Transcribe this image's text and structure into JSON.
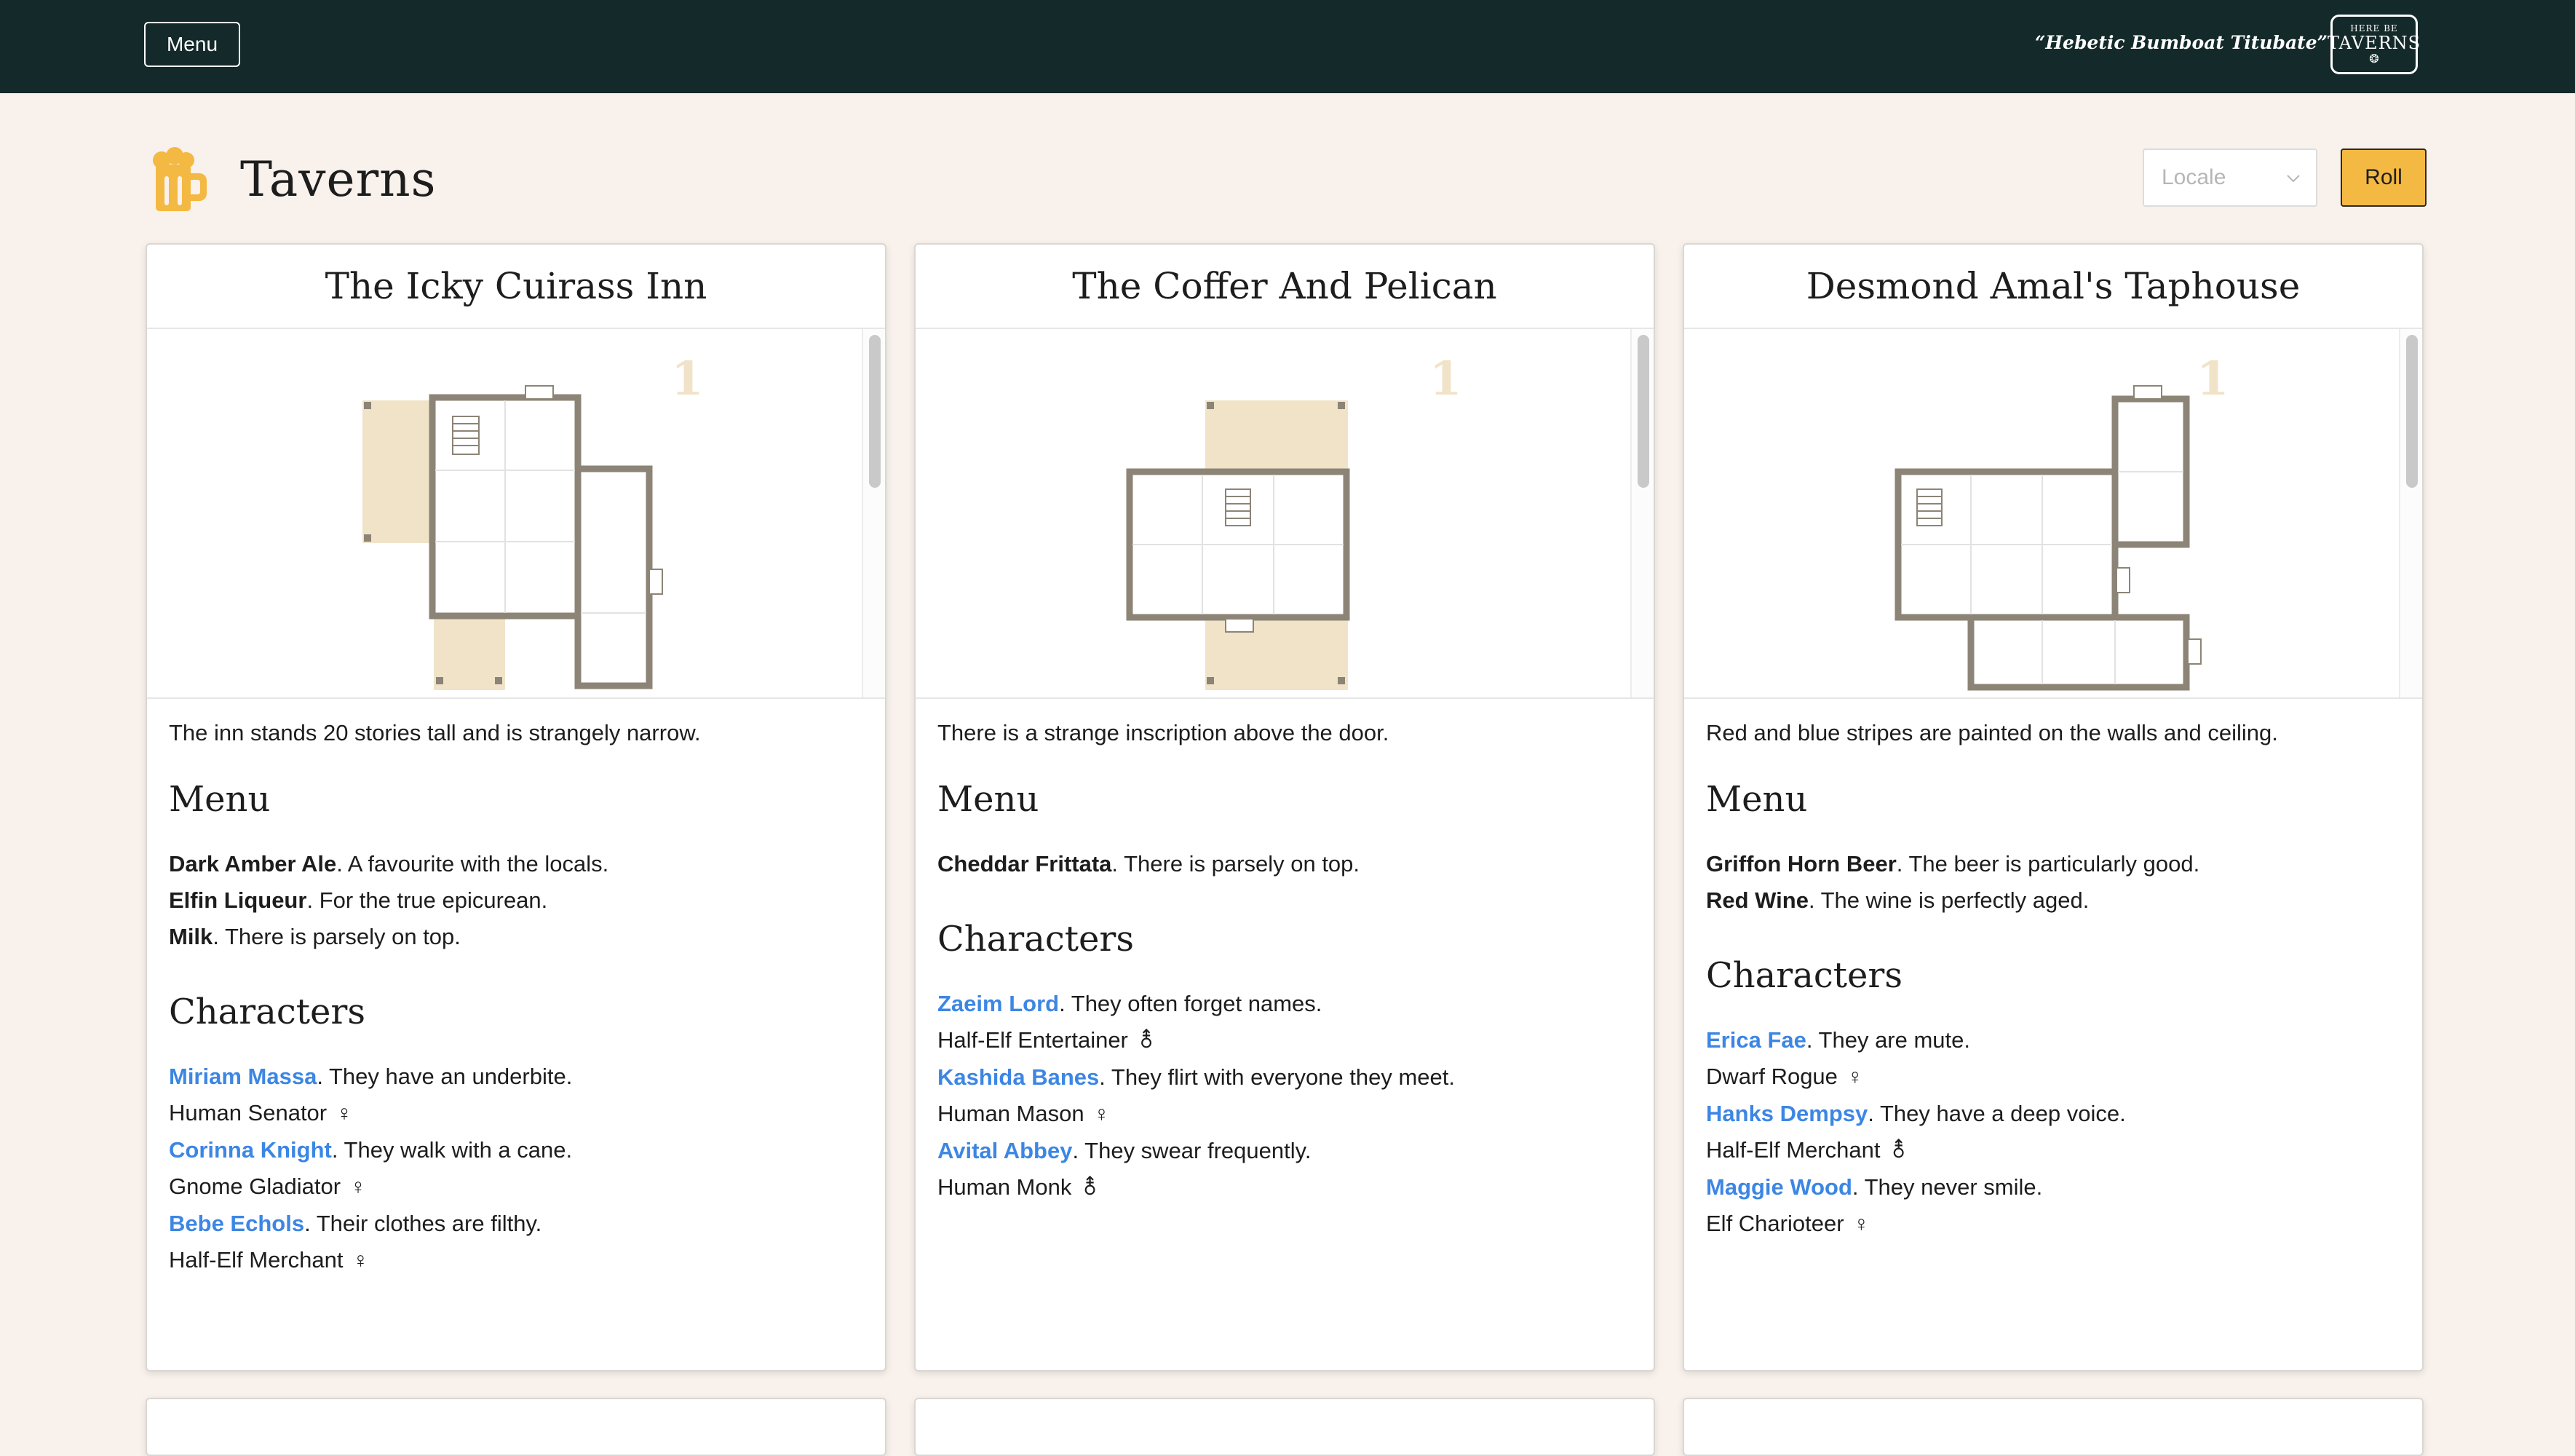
{
  "topbar": {
    "menu_label": "Menu",
    "quote": "“Hebetic Bumboat Titubate”",
    "logo": {
      "line1": "HERE BE",
      "line2": "TAVERNS",
      "line3": "❂"
    }
  },
  "header": {
    "title": "Taverns",
    "locale_placeholder": "Locale",
    "roll_label": "Roll"
  },
  "colors": {
    "accent": "#f4b942",
    "topbar": "#13292a",
    "link": "#3c86e4",
    "floor_fill": "#f0e3c8"
  },
  "cards": [
    {
      "name": "The Icky Cuirass Inn",
      "floor_number": "1",
      "description": "The inn stands 20 stories tall and is strangely narrow.",
      "menu_heading": "Menu",
      "menu": [
        {
          "item": "Dark Amber Ale",
          "note": ". A favourite with the locals."
        },
        {
          "item": "Elfin Liqueur",
          "note": ". For the true epicurean."
        },
        {
          "item": "Milk",
          "note": ". There is parsely on top."
        }
      ],
      "characters_heading": "Characters",
      "characters": [
        {
          "name": "Miriam Massa",
          "trait": ". They have an underbite.",
          "role": "Human Senator",
          "gender": "♀"
        },
        {
          "name": "Corinna Knight",
          "trait": ". They walk with a cane.",
          "role": "Gnome Gladiator",
          "gender": "♀"
        },
        {
          "name": "Bebe Echols",
          "trait": ". Their clothes are filthy.",
          "role": "Half-Elf Merchant",
          "gender": "♀"
        }
      ]
    },
    {
      "name": "The Coffer And Pelican",
      "floor_number": "1",
      "description": "There is a strange inscription above the door.",
      "menu_heading": "Menu",
      "menu": [
        {
          "item": "Cheddar Frittata",
          "note": ". There is parsely on top."
        }
      ],
      "characters_heading": "Characters",
      "characters": [
        {
          "name": "Zaeim Lord",
          "trait": ". They often forget names.",
          "role": "Half-Elf Entertainer",
          "gender": "⚨"
        },
        {
          "name": "Kashida Banes",
          "trait": ". They flirt with everyone they meet.",
          "role": "Human Mason",
          "gender": "♀"
        },
        {
          "name": "Avital Abbey",
          "trait": ". They swear frequently.",
          "role": "Human Monk",
          "gender": "⚨"
        }
      ]
    },
    {
      "name": "Desmond Amal's Taphouse",
      "floor_number": "1",
      "description": "Red and blue stripes are painted on the walls and ceiling.",
      "menu_heading": "Menu",
      "menu": [
        {
          "item": "Griffon Horn Beer",
          "note": ". The beer is particularly good."
        },
        {
          "item": "Red Wine",
          "note": ". The wine is perfectly aged."
        }
      ],
      "characters_heading": "Characters",
      "characters": [
        {
          "name": "Erica Fae",
          "trait": ". They are mute.",
          "role": "Dwarf Rogue",
          "gender": "♀"
        },
        {
          "name": "Hanks Dempsy",
          "trait": ". They have a deep voice.",
          "role": "Half-Elf Merchant",
          "gender": "⚨"
        },
        {
          "name": "Maggie Wood",
          "trait": ". They never smile.",
          "role": "Elf Charioteer",
          "gender": "♀"
        }
      ]
    }
  ]
}
